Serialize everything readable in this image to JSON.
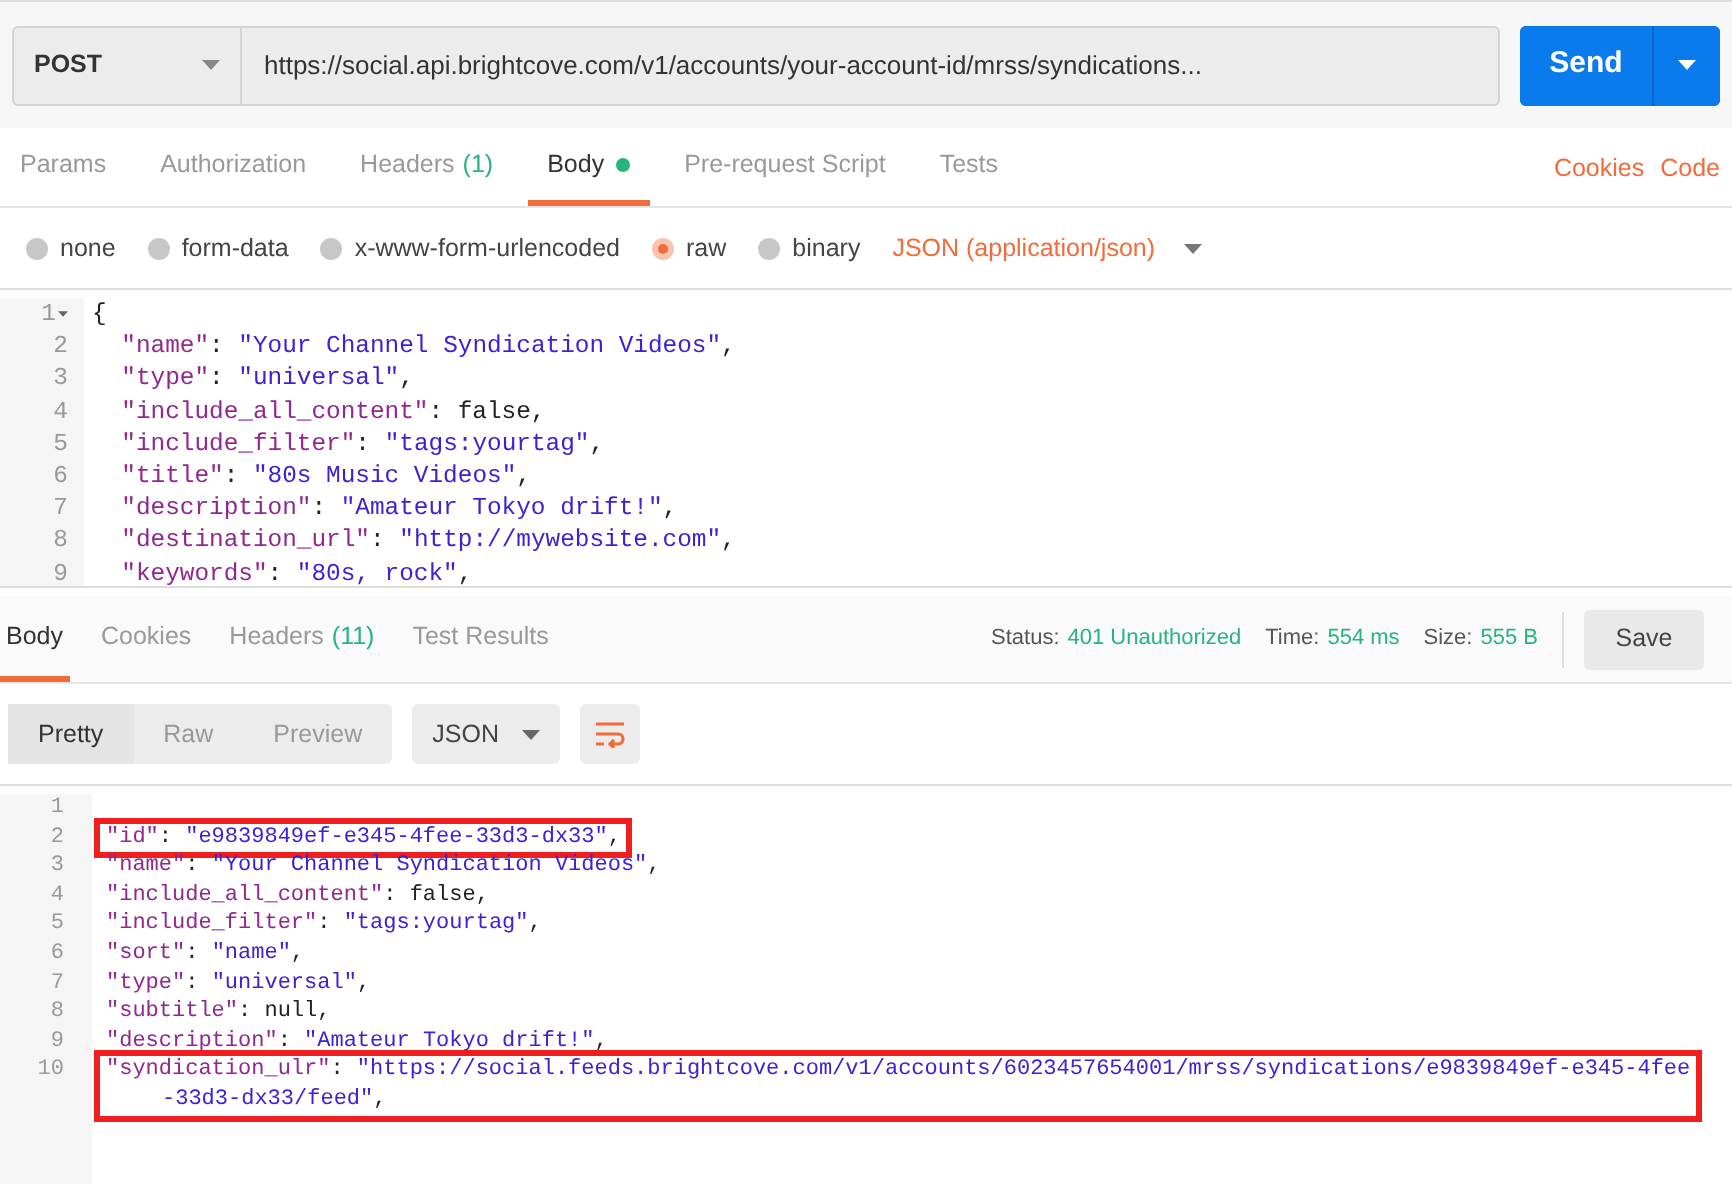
{
  "request": {
    "method": "POST",
    "url": "https://social.api.brightcove.com/v1/accounts/your-account-id/mrss/syndications...",
    "send": "Send"
  },
  "request_tabs": [
    {
      "label": "Params",
      "selected": false
    },
    {
      "label": "Authorization",
      "selected": false
    },
    {
      "label": "Headers",
      "count": "(1)",
      "selected": false
    },
    {
      "label": "Body",
      "dot": true,
      "selected": true
    },
    {
      "label": "Pre-request Script",
      "selected": false
    },
    {
      "label": "Tests",
      "selected": false
    }
  ],
  "request_links": [
    "Cookies",
    "Code"
  ],
  "body_types": [
    {
      "label": "none",
      "selected": false
    },
    {
      "label": "form-data",
      "selected": false
    },
    {
      "label": "x-www-form-urlencoded",
      "selected": false
    },
    {
      "label": "raw",
      "selected": true
    },
    {
      "label": "binary",
      "selected": false
    }
  ],
  "content_type": "JSON (application/json)",
  "request_body": [
    {
      "number": "1",
      "fold": true,
      "tokens": [
        {
          "kind": "punct",
          "text": "{"
        }
      ]
    },
    {
      "number": "2",
      "tokens": [
        {
          "kind": "key",
          "text": "\"name\""
        },
        {
          "kind": "punct",
          "text": ": "
        },
        {
          "kind": "string",
          "text": "\"Your Channel Syndication Videos\""
        },
        {
          "kind": "punct",
          "text": ","
        }
      ]
    },
    {
      "number": "3",
      "tokens": [
        {
          "kind": "key",
          "text": "\"type\""
        },
        {
          "kind": "punct",
          "text": ": "
        },
        {
          "kind": "string",
          "text": "\"universal\""
        },
        {
          "kind": "punct",
          "text": ","
        }
      ]
    },
    {
      "number": "4",
      "tokens": [
        {
          "kind": "key",
          "text": "\"include_all_content\""
        },
        {
          "kind": "punct",
          "text": ": false,"
        }
      ]
    },
    {
      "number": "5",
      "tokens": [
        {
          "kind": "key",
          "text": "\"include_filter\""
        },
        {
          "kind": "punct",
          "text": ": "
        },
        {
          "kind": "string",
          "text": "\"tags:yourtag\""
        },
        {
          "kind": "punct",
          "text": ","
        }
      ]
    },
    {
      "number": "6",
      "tokens": [
        {
          "kind": "key",
          "text": "\"title\""
        },
        {
          "kind": "punct",
          "text": ": "
        },
        {
          "kind": "string",
          "text": "\"80s Music Videos\""
        },
        {
          "kind": "punct",
          "text": ","
        }
      ]
    },
    {
      "number": "7",
      "tokens": [
        {
          "kind": "key",
          "text": "\"description\""
        },
        {
          "kind": "punct",
          "text": ": "
        },
        {
          "kind": "string",
          "text": "\"Amateur Tokyo drift!\""
        },
        {
          "kind": "punct",
          "text": ","
        }
      ]
    },
    {
      "number": "8",
      "tokens": [
        {
          "kind": "key",
          "text": "\"destination_url\""
        },
        {
          "kind": "punct",
          "text": ": "
        },
        {
          "kind": "string",
          "text": "\"http://mywebsite.com\""
        },
        {
          "kind": "punct",
          "text": ","
        }
      ]
    },
    {
      "number": "9",
      "tokens": [
        {
          "kind": "key",
          "text": "\"keywords\""
        },
        {
          "kind": "punct",
          "text": ": "
        },
        {
          "kind": "string",
          "text": "\"80s, rock\""
        },
        {
          "kind": "punct",
          "text": ","
        }
      ]
    }
  ],
  "response_tabs": [
    {
      "label": "Body",
      "selected": true
    },
    {
      "label": "Cookies",
      "selected": false
    },
    {
      "label": "Headers",
      "count": "(11)",
      "selected": false
    },
    {
      "label": "Test Results",
      "selected": false
    }
  ],
  "response_meta": [
    {
      "label": "Status:",
      "value": "401 Unauthorized"
    },
    {
      "label": "Time:",
      "value": "554 ms"
    },
    {
      "label": "Size:",
      "value": "555 B"
    }
  ],
  "save": "Save",
  "view_modes": [
    {
      "label": "Pretty",
      "selected": true
    },
    {
      "label": "Raw",
      "selected": false
    },
    {
      "label": "Preview",
      "selected": false
    }
  ],
  "format": "JSON",
  "wrap_on": true,
  "response_body": [
    {
      "number": "1",
      "highlighted": false
    },
    {
      "number": "2",
      "highlighted": true,
      "tokens": [
        {
          "kind": "key",
          "text": "\"id\""
        },
        {
          "kind": "punct",
          "text": ": "
        },
        {
          "kind": "string",
          "text": "\"e9839849ef-e345-4fee-33d3-dx33\""
        },
        {
          "kind": "punct",
          "text": ","
        }
      ]
    },
    {
      "number": "3",
      "highlighted": false,
      "tokens": [
        {
          "kind": "key",
          "text": "\"name\""
        },
        {
          "kind": "punct",
          "text": ": "
        },
        {
          "kind": "string",
          "text": "\"Your Channel Syndication Videos\""
        },
        {
          "kind": "punct",
          "text": ","
        }
      ]
    },
    {
      "number": "4",
      "highlighted": false,
      "tokens": [
        {
          "kind": "key",
          "text": "\"include_all_content\""
        },
        {
          "kind": "punct",
          "text": ": false,"
        }
      ]
    },
    {
      "number": "5",
      "highlighted": false,
      "tokens": [
        {
          "kind": "key",
          "text": "\"include_filter\""
        },
        {
          "kind": "punct",
          "text": ": "
        },
        {
          "kind": "string",
          "text": "\"tags:yourtag\""
        },
        {
          "kind": "punct",
          "text": ","
        }
      ]
    },
    {
      "number": "6",
      "highlighted": false,
      "tokens": [
        {
          "kind": "key",
          "text": "\"sort\""
        },
        {
          "kind": "punct",
          "text": ": "
        },
        {
          "kind": "string",
          "text": "\"name\""
        },
        {
          "kind": "punct",
          "text": ","
        }
      ]
    },
    {
      "number": "7",
      "highlighted": false,
      "tokens": [
        {
          "kind": "key",
          "text": "\"type\""
        },
        {
          "kind": "punct",
          "text": ": "
        },
        {
          "kind": "string",
          "text": "\"universal\""
        },
        {
          "kind": "punct",
          "text": ","
        }
      ]
    },
    {
      "number": "8",
      "highlighted": false,
      "tokens": [
        {
          "kind": "key",
          "text": "\"subtitle\""
        },
        {
          "kind": "punct",
          "text": ": null,"
        }
      ]
    },
    {
      "number": "9",
      "highlighted": false,
      "tokens": [
        {
          "kind": "key",
          "text": "\"description\""
        },
        {
          "kind": "punct",
          "text": ": "
        },
        {
          "kind": "string",
          "text": "\"Amateur Tokyo drift!\""
        },
        {
          "kind": "punct",
          "text": ","
        }
      ]
    },
    {
      "number": "10",
      "highlighted": true,
      "tokens": [
        {
          "kind": "key",
          "text": "\"syndication_ulr\""
        },
        {
          "kind": "punct",
          "text": ": "
        },
        {
          "kind": "string",
          "text": "\"https://social.feeds.brightcove.com/v1/accounts/6023457654001/mrss/syndications/e9839849ef-e345-4fee"
        }
      ],
      "wrap": [
        {
          "kind": "string",
          "text": "-33d3-dx33/feed\""
        },
        {
          "kind": "punct",
          "text": ","
        }
      ]
    }
  ]
}
